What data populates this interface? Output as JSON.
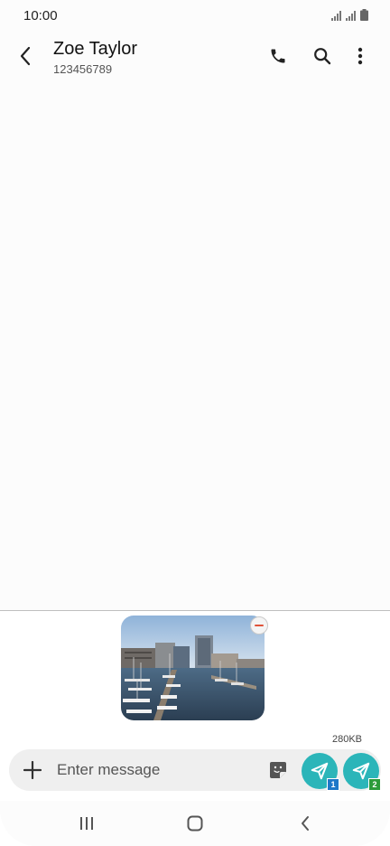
{
  "status_bar": {
    "time": "10:00"
  },
  "header": {
    "contact_name": "Zoe Taylor",
    "phone_number": "123456789"
  },
  "icons": {
    "back": "back-arrow-icon",
    "call": "phone-icon",
    "search": "search-icon",
    "more": "more-vertical-icon",
    "remove": "minus-icon",
    "add": "plus-icon",
    "sticker": "sticker-icon",
    "send": "send-icon"
  },
  "attachment": {
    "size": "280KB"
  },
  "composer": {
    "placeholder": "Enter message"
  },
  "send_buttons": [
    {
      "sim": "1",
      "badge_color": "#1e78c8"
    },
    {
      "sim": "2",
      "badge_color": "#2c9b3a"
    }
  ],
  "colors": {
    "accent": "#2bb5b9"
  }
}
